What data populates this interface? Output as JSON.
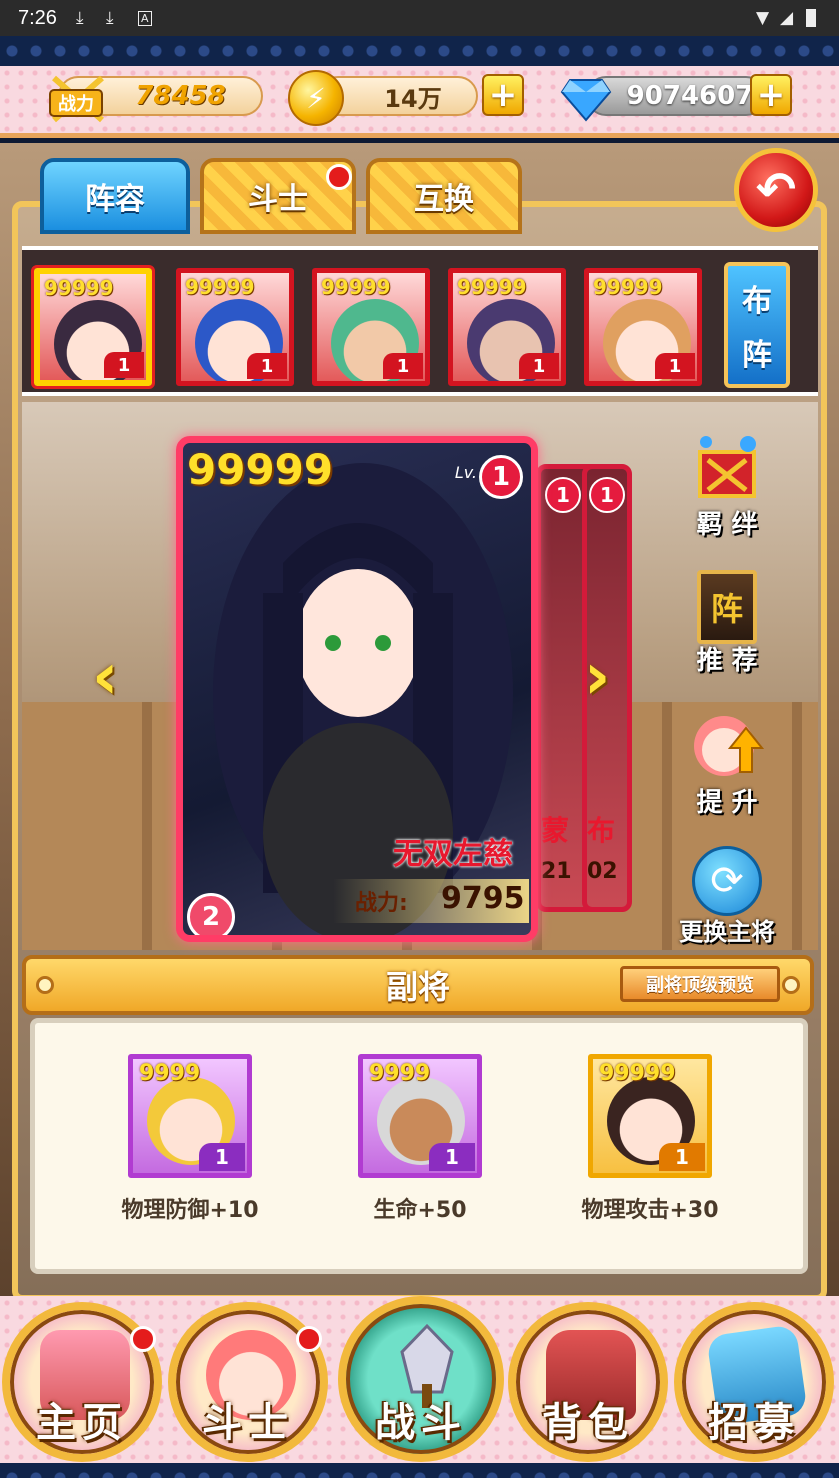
{
  "status_bar": {
    "time": "7:26",
    "icons": [
      "download-icon",
      "download-icon",
      "a-icon",
      "wifi-icon",
      "signal-icon",
      "battery-icon"
    ]
  },
  "resources": {
    "power_label": "战力",
    "power": "78458",
    "coin_symbol": "⚡",
    "coins": "14万",
    "gems": "9074607"
  },
  "tabs": [
    {
      "label": "阵容",
      "active": true
    },
    {
      "label": "斗士",
      "active": false,
      "badge": true
    },
    {
      "label": "互换",
      "active": false
    }
  ],
  "lineup": {
    "heroes": [
      {
        "stars": "99999",
        "level": "1",
        "color": "#3a2a40"
      },
      {
        "stars": "99999",
        "level": "1",
        "color": "#2c58c8"
      },
      {
        "stars": "99999",
        "level": "1",
        "color": "#4fb88e"
      },
      {
        "stars": "99999",
        "level": "1",
        "color": "#4a3a70"
      },
      {
        "stars": "99999",
        "level": "1",
        "color": "#e0a060"
      }
    ],
    "formation_label_1": "布",
    "formation_label_2": "阵"
  },
  "main_card": {
    "stars": "99999",
    "lv_label": "Lv.",
    "level": "1",
    "name": "无双左慈",
    "power_label": "战力:",
    "power": "9795",
    "rank": "2"
  },
  "back_cards": [
    {
      "level": "1",
      "text": "蒙",
      "num": "21"
    },
    {
      "level": "1",
      "text": "布",
      "num": "02"
    }
  ],
  "side_buttons": {
    "bond": "羁 绊",
    "recommend": "推 荐",
    "recommend_icon_text": "阵",
    "upgrade": "提 升",
    "change": "更换主将"
  },
  "sub_generals": {
    "title": "副将",
    "preview": "副将顶级预览",
    "items": [
      {
        "stars": "9999",
        "level": "1",
        "bonus": "物理防御+10",
        "tier": "purple"
      },
      {
        "stars": "9999",
        "level": "1",
        "bonus": "生命+50",
        "tier": "purple"
      },
      {
        "stars": "99999",
        "level": "1",
        "bonus": "物理攻击+30",
        "tier": "gold"
      }
    ]
  },
  "nav": [
    {
      "label": "主页",
      "badge": true
    },
    {
      "label": "斗士",
      "badge": true
    },
    {
      "label": "战斗",
      "badge": false
    },
    {
      "label": "背包",
      "badge": false
    },
    {
      "label": "招募",
      "badge": false
    }
  ]
}
